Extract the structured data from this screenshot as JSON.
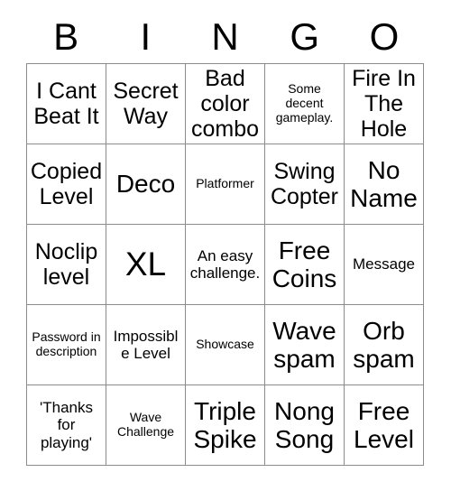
{
  "header": {
    "letters": [
      "B",
      "I",
      "N",
      "G",
      "O"
    ]
  },
  "theme": {
    "background": "#ffffff",
    "border_color": "#8c8c8c",
    "text_color": "#000000"
  },
  "grid": {
    "rows": 5,
    "columns": 5,
    "cells": [
      {
        "text": "I Cant Beat It",
        "size": "md"
      },
      {
        "text": "Secret Way",
        "size": "md"
      },
      {
        "text": "Bad color combo",
        "size": "md"
      },
      {
        "text": "Some decent gameplay.",
        "size": "xs"
      },
      {
        "text": "Fire In The Hole",
        "size": "md"
      },
      {
        "text": "Copied Level",
        "size": "md"
      },
      {
        "text": "Deco",
        "size": "lg"
      },
      {
        "text": "Platformer",
        "size": "xs"
      },
      {
        "text": "Swing Copter",
        "size": "md"
      },
      {
        "text": "No Name",
        "size": "lg"
      },
      {
        "text": "Noclip level",
        "size": "md"
      },
      {
        "text": "XL",
        "size": "xl"
      },
      {
        "text": "An easy challenge.",
        "size": "sm"
      },
      {
        "text": "Free Coins",
        "size": "lg"
      },
      {
        "text": "Message",
        "size": "sm"
      },
      {
        "text": "Password in description",
        "size": "xs"
      },
      {
        "text": "Impossible Level",
        "size": "sm"
      },
      {
        "text": "Showcase",
        "size": "xs"
      },
      {
        "text": "Wave spam",
        "size": "lg"
      },
      {
        "text": "Orb spam",
        "size": "lg"
      },
      {
        "text": "'Thanks for playing'",
        "size": "sm"
      },
      {
        "text": "Wave Challenge",
        "size": "xs"
      },
      {
        "text": "Triple Spike",
        "size": "lg"
      },
      {
        "text": "Nong Song",
        "size": "lg"
      },
      {
        "text": "Free Level",
        "size": "lg"
      }
    ]
  }
}
